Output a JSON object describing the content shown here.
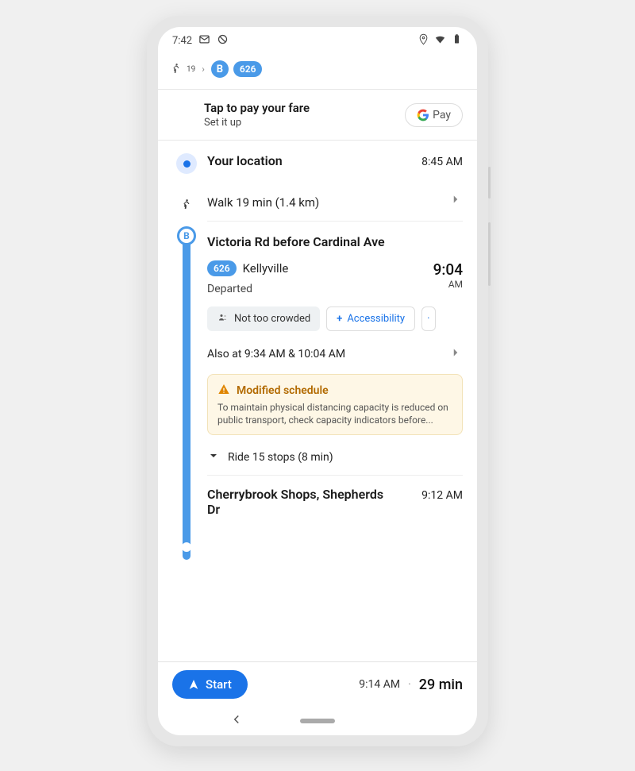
{
  "statusbar": {
    "time": "7:42"
  },
  "summary": {
    "walk_minutes": "19",
    "bus_letter": "B",
    "bus_number": "626"
  },
  "paycard": {
    "title": "Tap to pay your fare",
    "subtitle": "Set it up",
    "pay_label": "Pay"
  },
  "origin": {
    "label": "Your location",
    "time": "8:45 AM"
  },
  "walk_step": {
    "label": "Walk 19 min (1.4 km)"
  },
  "bus_stop": {
    "name": "Victoria Rd before Cardinal Ave",
    "route": "626",
    "destination": "Kellyville",
    "status": "Departed",
    "depart_time": "9:04",
    "depart_ampm": "AM",
    "crowd_label": "Not too crowded",
    "access_label": "Accessibility",
    "also_at": "Also at 9:34 AM & 10:04 AM",
    "alert_title": "Modified schedule",
    "alert_body": "To maintain physical distancing capacity is reduced on public transport, check capacity indicators before...",
    "ride_label": "Ride 15 stops (8 min)"
  },
  "next_stop": {
    "name": "Cherrybrook Shops, Shepherds Dr",
    "time": "9:12 AM"
  },
  "footer": {
    "start_label": "Start",
    "arrival": "9:14 AM",
    "duration": "29 min"
  }
}
